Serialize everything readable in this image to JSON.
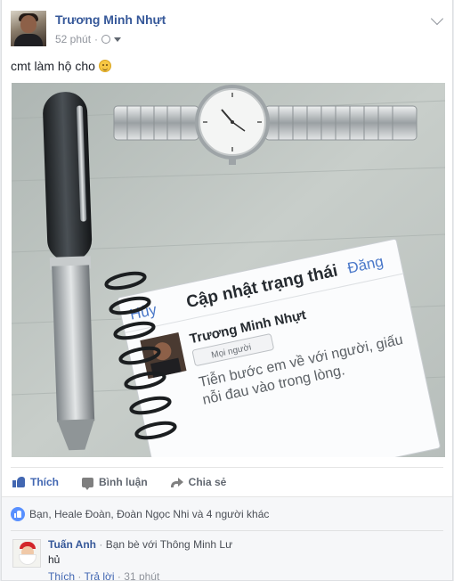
{
  "post": {
    "author": "Trương Minh Nhựt",
    "time": "52 phút",
    "privacy_icon": "globe-icon",
    "text": "cmt làm hộ cho",
    "emoji": "slightly-smiling-face-icon"
  },
  "photo": {
    "dialog_title": "Cập nhật trạng thái",
    "cancel": "Hủy",
    "post_btn": "Đăng",
    "name": "Trương Minh Nhựt",
    "audience": "Mọi người",
    "status_line1": "Tiễn bước em về với người, giấu",
    "status_line2": "nỗi đau vào trong lòng."
  },
  "actions": {
    "like": "Thích",
    "comment": "Bình luận",
    "share": "Chia sẻ"
  },
  "reactions": {
    "summary": "Bạn, Heale Đoàn, Đoàn Ngọc Nhi và 4 người khác"
  },
  "comment": {
    "author": "Tuấn Anh",
    "separator": "·",
    "relation": "Bạn bè với Thông Minh Lư",
    "text": "hủ",
    "like": "Thích",
    "reply": "Trả lời",
    "time": "31 phút",
    "avatar_text": "Tuấn Anh"
  },
  "colors": {
    "link": "#365899",
    "accent": "#4267b2",
    "meta": "#90949c",
    "background": "#e9ebee"
  }
}
